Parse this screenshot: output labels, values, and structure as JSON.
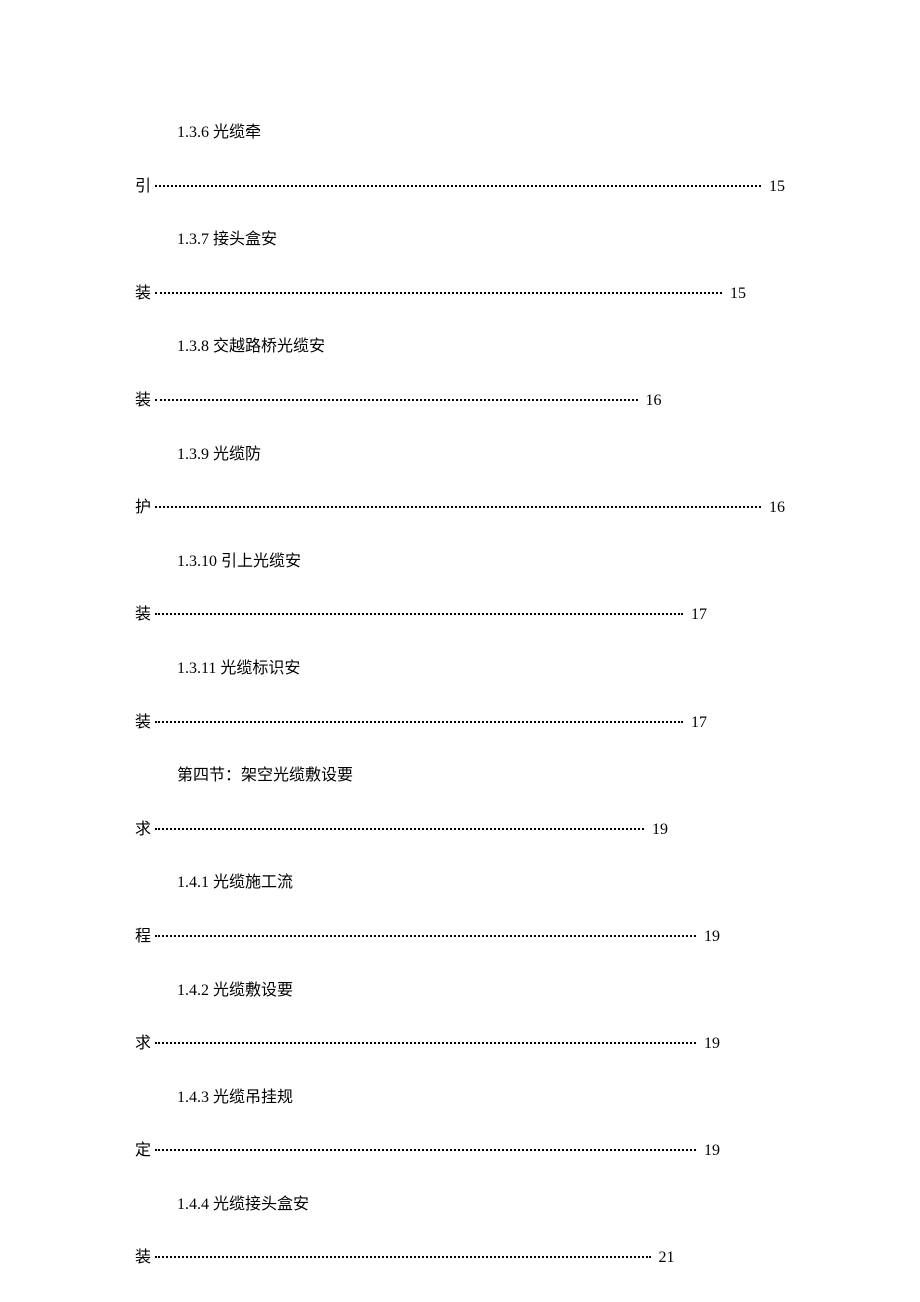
{
  "toc": {
    "entries": [
      {
        "title": "1.3.6 光缆牵",
        "continuation": "引",
        "page": "15",
        "widthClass": "w-full"
      },
      {
        "title": "1.3.7 接头盒安",
        "continuation": "装",
        "page": "15",
        "widthClass": "w-94"
      },
      {
        "title": "1.3.8 交越路桥光缆安",
        "continuation": "装",
        "page": "16",
        "widthClass": "w-81"
      },
      {
        "title": "1.3.9 光缆防",
        "continuation": "护",
        "page": "16",
        "widthClass": "w-full"
      },
      {
        "title": "1.3.10 引上光缆安",
        "continuation": "装",
        "page": "17",
        "widthClass": "w-88"
      },
      {
        "title": "1.3.11 光缆标识安",
        "continuation": "装",
        "page": "17",
        "widthClass": "w-88"
      },
      {
        "title": "第四节：架空光缆敷设要",
        "continuation": "求",
        "page": "19",
        "widthClass": "w-82"
      },
      {
        "title": "1.4.1 光缆施工流",
        "continuation": "程",
        "page": "19",
        "widthClass": "w-90"
      },
      {
        "title": "1.4.2 光缆敷设要",
        "continuation": "求",
        "page": "19",
        "widthClass": "w-90"
      },
      {
        "title": "1.4.3 光缆吊挂规",
        "continuation": "定",
        "page": "19",
        "widthClass": "w-90"
      },
      {
        "title": "1.4.4 光缆接头盒安",
        "continuation": "装",
        "page": "21",
        "widthClass": "w-83"
      }
    ]
  }
}
